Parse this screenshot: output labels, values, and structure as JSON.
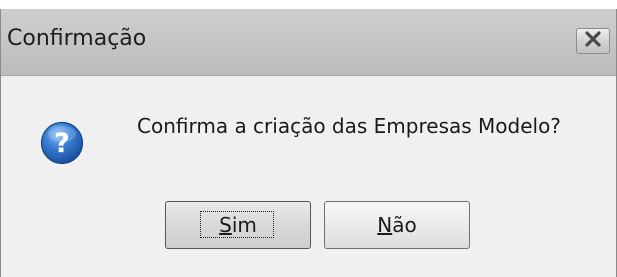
{
  "dialog": {
    "title": "Confirmação",
    "message": "Confirma a criação das Empresas Modelo?",
    "icon": "question-icon",
    "accent_color": "#2f6fc4"
  },
  "buttons": {
    "yes": {
      "mnemonic": "S",
      "rest": "im",
      "label": "Sim"
    },
    "no": {
      "mnemonic": "N",
      "rest": "ão",
      "label": "Não"
    }
  },
  "close_icon": "close-icon"
}
